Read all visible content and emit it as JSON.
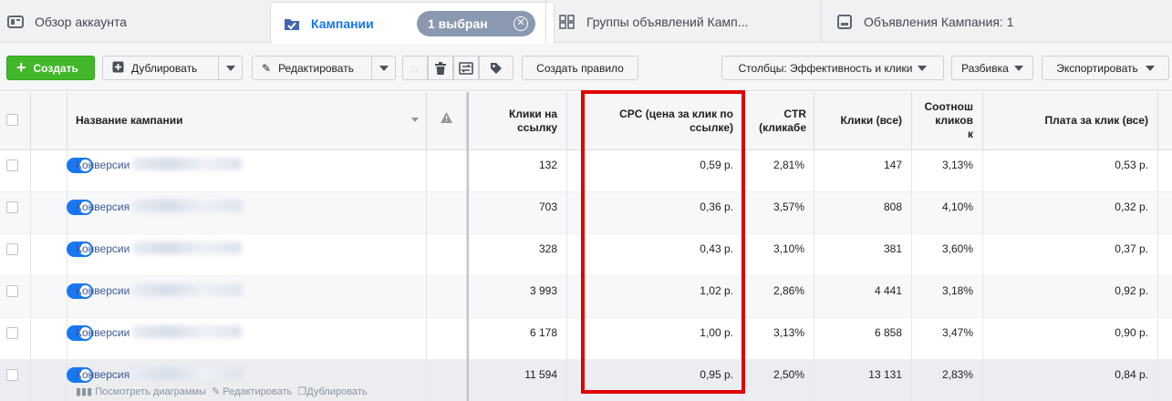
{
  "tabs": {
    "overview": "Обзор аккаунта",
    "campaigns": "Кампании",
    "selected_badge": "1 выбран",
    "adsets": "Группы объявлений Камп...",
    "ads": "Объявления Кампания: 1"
  },
  "toolbar": {
    "create": "Создать",
    "duplicate": "Дублировать",
    "edit": "Редактировать",
    "create_rule": "Создать правило",
    "columns": "Столбцы: Эффективность и клики",
    "breakdown": "Разбивка",
    "export": "Экспортировать"
  },
  "table": {
    "headers": {
      "name": "Название кампании",
      "link_clicks": [
        "Клики на",
        "ссылку"
      ],
      "cpc": [
        "CPC (цена за клик по",
        "ссылке)"
      ],
      "ctr": [
        "CTR",
        "(кликабе"
      ],
      "clicks_all": "Клики (все)",
      "ratio": [
        "Соотнош",
        "кликов",
        "к"
      ],
      "cost_per_click": "Плата за клик (все)"
    },
    "rows": [
      {
        "name": "Конверсии",
        "link_clicks": "132",
        "cpc": "0,59 р.",
        "ctr": "2,81%",
        "clicks_all": "147",
        "ratio": "3,13%",
        "cost": "0,53 р."
      },
      {
        "name": "Конверсия",
        "link_clicks": "703",
        "cpc": "0,36 р.",
        "ctr": "3,57%",
        "clicks_all": "808",
        "ratio": "4,10%",
        "cost": "0,32 р."
      },
      {
        "name": "Конверсии",
        "link_clicks": "328",
        "cpc": "0,43 р.",
        "ctr": "3,10%",
        "clicks_all": "381",
        "ratio": "3,60%",
        "cost": "0,37 р."
      },
      {
        "name": "Конверсии",
        "link_clicks": "3 993",
        "cpc": "1,02 р.",
        "ctr": "2,86%",
        "clicks_all": "4 441",
        "ratio": "3,18%",
        "cost": "0,92 р."
      },
      {
        "name": "Конверсии",
        "link_clicks": "6 178",
        "cpc": "1,00 р.",
        "ctr": "3,13%",
        "clicks_all": "6 858",
        "ratio": "3,47%",
        "cost": "0,90 р."
      },
      {
        "name": "Конверсия",
        "link_clicks": "11 594",
        "cpc": "0,95 р.",
        "ctr": "2,50%",
        "clicks_all": "13 131",
        "ratio": "2,83%",
        "cost": "0,84 р."
      }
    ],
    "row_actions": {
      "charts": "Посмотреть диаграммы",
      "edit": "Редактировать",
      "duplicate": "Дублировать"
    }
  },
  "colors": {
    "accent": "#1877f2",
    "create_green": "#42b72a",
    "highlight_red": "#e00000"
  }
}
